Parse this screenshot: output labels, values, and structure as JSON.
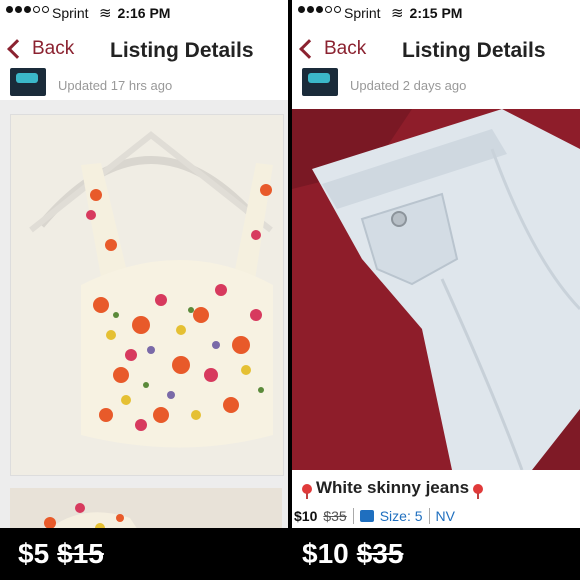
{
  "left": {
    "status": {
      "carrier": "Sprint",
      "time": "2:16 PM"
    },
    "nav": {
      "back_label": "Back",
      "title": "Listing Details"
    },
    "user": {
      "updated": "Updated 17 hrs ago"
    }
  },
  "right": {
    "status": {
      "carrier": "Sprint",
      "time": "2:15 PM"
    },
    "nav": {
      "back_label": "Back",
      "title": "Listing Details"
    },
    "user": {
      "updated": "Updated 2 days ago"
    },
    "item": {
      "title": "White skinny jeans",
      "price": "$10",
      "original_price": "$35",
      "size": "Size: 5",
      "brand": "NV"
    }
  },
  "footer": {
    "left": {
      "price": "$5",
      "original_price": "$15"
    },
    "right": {
      "price": "$10",
      "original_price": "$35"
    }
  },
  "colors": {
    "accent": "#8b2230",
    "link": "#1f6fbf",
    "pin": "#e03a3a"
  },
  "icons": [
    "wifi-icon",
    "back-chevron-icon",
    "size-hanger-icon",
    "pin-icon"
  ]
}
